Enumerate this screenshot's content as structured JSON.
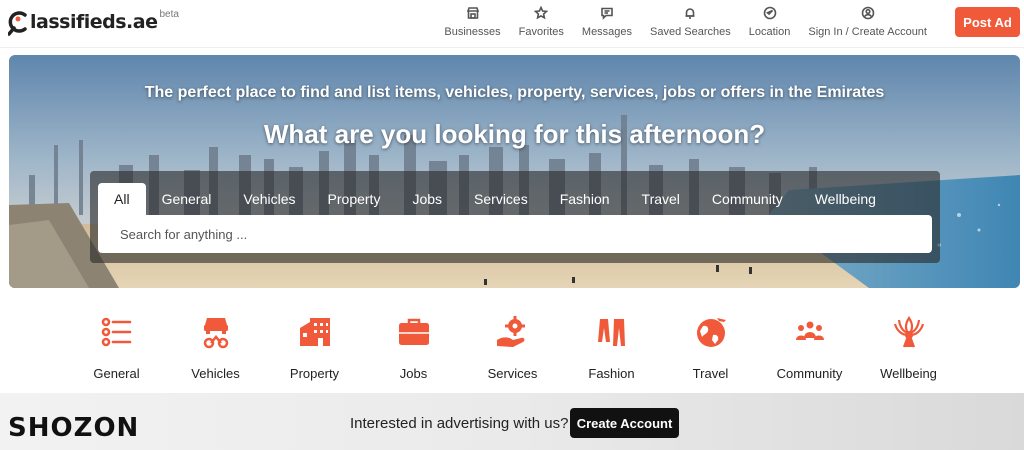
{
  "brand": {
    "logo_text": "lassifieds.ae",
    "beta_label": "beta"
  },
  "nav": [
    {
      "label": "Businesses",
      "icon": "storefront-icon"
    },
    {
      "label": "Favorites",
      "icon": "star-icon"
    },
    {
      "label": "Messages",
      "icon": "message-icon"
    },
    {
      "label": "Saved Searches",
      "icon": "bell-icon"
    },
    {
      "label": "Location",
      "icon": "location-arrow-icon"
    },
    {
      "label": "Sign In / Create Account",
      "icon": "user-circle-icon"
    }
  ],
  "post_ad_label": "Post Ad",
  "hero": {
    "tagline": "The perfect place to find and list items, vehicles, property, services, jobs or offers in the Emirates",
    "question": "What are you looking for this afternoon?"
  },
  "search": {
    "tabs": [
      "All",
      "General",
      "Vehicles",
      "Property",
      "Jobs",
      "Services",
      "Fashion",
      "Travel",
      "Community",
      "Wellbeing"
    ],
    "active_tab": "All",
    "placeholder": "Search for anything ..."
  },
  "categories": [
    {
      "label": "General",
      "icon": "list-icon"
    },
    {
      "label": "Vehicles",
      "icon": "vehicles-icon"
    },
    {
      "label": "Property",
      "icon": "building-icon"
    },
    {
      "label": "Jobs",
      "icon": "briefcase-icon"
    },
    {
      "label": "Services",
      "icon": "gear-hand-icon"
    },
    {
      "label": "Fashion",
      "icon": "clothes-icon"
    },
    {
      "label": "Travel",
      "icon": "globe-plane-icon"
    },
    {
      "label": "Community",
      "icon": "people-icon"
    },
    {
      "label": "Wellbeing",
      "icon": "lotus-person-icon"
    }
  ],
  "banner": {
    "brand": "SHOZON",
    "text": "Interested in advertising with us?",
    "button_label": "Create Account"
  },
  "colors": {
    "accent": "#f05a3a",
    "dark": "#111111"
  }
}
